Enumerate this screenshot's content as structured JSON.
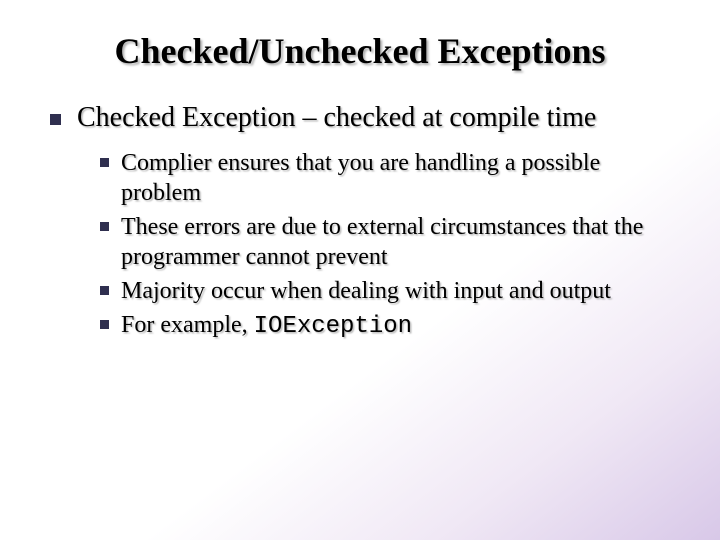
{
  "title": "Checked/Unchecked Exceptions",
  "level1": {
    "item0": "Checked Exception – checked at compile time"
  },
  "level2": {
    "item0": "Complier ensures that you are handling a possible problem",
    "item1": "These errors are due to external circumstances that the programmer cannot prevent",
    "item2": "Majority occur when dealing with input and output",
    "item3_prefix": "For example, ",
    "item3_code": "IOException"
  }
}
